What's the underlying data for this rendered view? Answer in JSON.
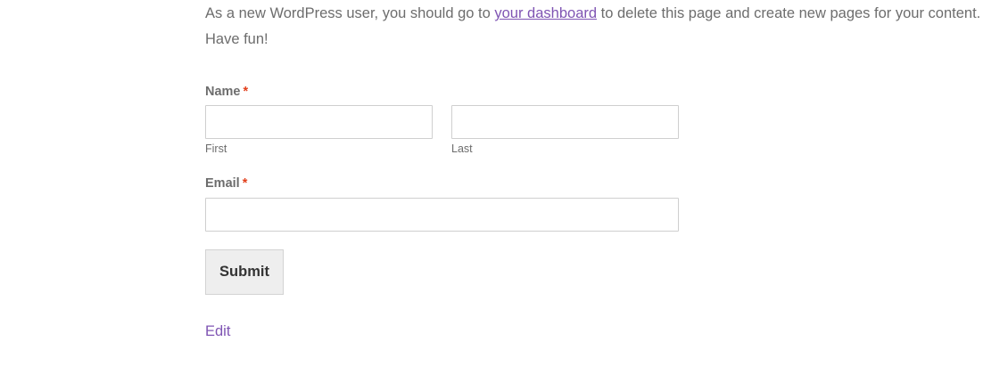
{
  "intro": {
    "before_link": "As a new WordPress user, you should go to ",
    "link_text": "your dashboard",
    "after_link": " to delete this page and create new pages for your content.",
    "line2": "Have fun!"
  },
  "form": {
    "name_label": "Name",
    "required_marker": "*",
    "first_value": "",
    "first_sublabel": "First",
    "last_value": "",
    "last_sublabel": "Last",
    "email_label": "Email",
    "email_value": "",
    "submit_label": "Submit"
  },
  "edit_link": "Edit",
  "colors": {
    "link": "#7f54b3",
    "required": "#e2401c",
    "text": "#6d6d6d",
    "button_bg": "#eeeeee"
  }
}
